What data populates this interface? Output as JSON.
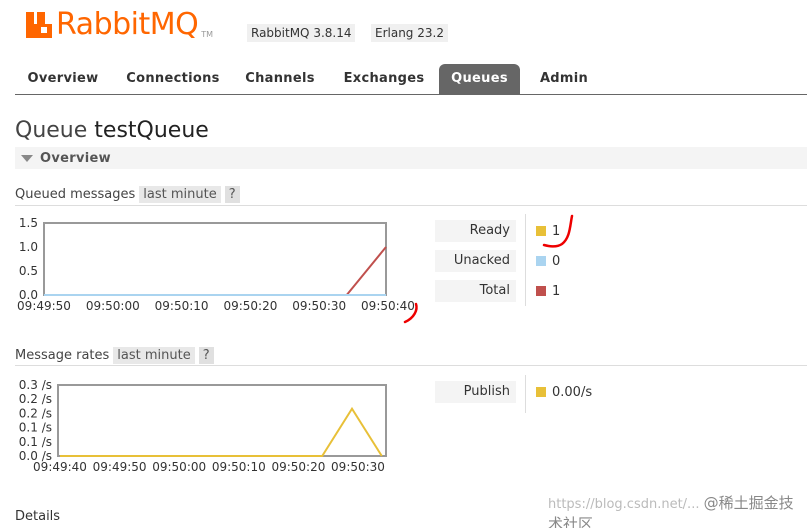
{
  "app": {
    "logo_text": "RabbitMQ",
    "logo_tm": "TM",
    "version_rabbit": "RabbitMQ 3.8.14",
    "version_erlang": "Erlang 23.2",
    "brand_color": "#ff6600"
  },
  "tabs": [
    {
      "label": "Overview",
      "active": false
    },
    {
      "label": "Connections",
      "active": false
    },
    {
      "label": "Channels",
      "active": false
    },
    {
      "label": "Exchanges",
      "active": false
    },
    {
      "label": "Queues",
      "active": true
    },
    {
      "label": "Admin",
      "active": false
    }
  ],
  "page": {
    "title_prefix": "Queue",
    "title_name": "testQueue",
    "overview_section": "Overview",
    "details_label": "Details"
  },
  "queued_messages": {
    "heading": "Queued messages",
    "range": "last minute",
    "help": "?",
    "legend": [
      {
        "label": "Ready",
        "value": "1",
        "color": "#e8c038"
      },
      {
        "label": "Unacked",
        "value": "0",
        "color": "#aad4f0"
      },
      {
        "label": "Total",
        "value": "1",
        "color": "#c0504d"
      }
    ]
  },
  "message_rates": {
    "heading": "Message rates",
    "range": "last minute",
    "help": "?",
    "legend": [
      {
        "label": "Publish",
        "value": "0.00/s",
        "color": "#e8c038"
      }
    ]
  },
  "chart_data": [
    {
      "type": "line",
      "y_ticks": [
        "1.5",
        "1.0",
        "0.5",
        "0.0"
      ],
      "ylim": [
        0,
        1.5
      ],
      "x_ticks": [
        "09:49:50",
        "09:50:00",
        "09:50:10",
        "09:50:20",
        "09:50:30",
        "09:50:40"
      ],
      "series": [
        {
          "name": "Total",
          "color": "#c0504d",
          "x": [
            "09:49:50",
            "09:50:34",
            "09:50:40"
          ],
          "values": [
            0,
            0,
            1
          ]
        },
        {
          "name": "Unacked",
          "color": "#aad4f0",
          "x": [
            "09:49:50",
            "09:50:34",
            "09:50:40"
          ],
          "values": [
            0,
            0,
            0
          ]
        }
      ]
    },
    {
      "type": "line",
      "y_ticks": [
        "0.3 /s",
        "0.2 /s",
        "0.2 /s",
        "0.1 /s",
        "0.1 /s",
        "0.0 /s"
      ],
      "ylim": [
        0,
        0.3
      ],
      "x_ticks": [
        "09:49:40",
        "09:49:50",
        "09:50:00",
        "09:50:10",
        "09:50:20",
        "09:50:30"
      ],
      "series": [
        {
          "name": "Publish",
          "color": "#e8c038",
          "x": [
            "09:49:40",
            "09:50:24",
            "09:50:29",
            "09:50:34"
          ],
          "values": [
            0,
            0,
            0.2,
            0
          ]
        }
      ]
    }
  ],
  "watermark": {
    "url": "https://blog.csdn.net/...",
    "cn": "@稀土掘金技术社区"
  }
}
